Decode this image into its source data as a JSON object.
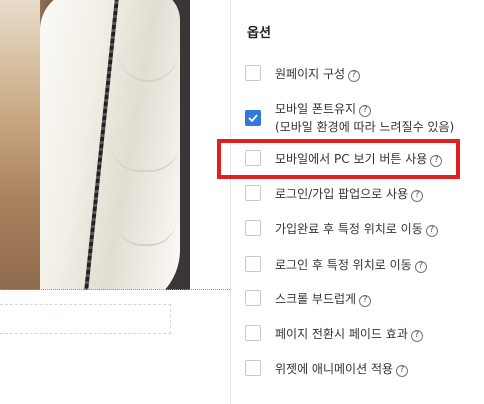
{
  "options_panel": {
    "title": "옵션",
    "help_icon_glyph": "?",
    "items": [
      {
        "label": "원페이지 구성",
        "checked": false
      },
      {
        "label": "모바일 폰트유지",
        "sublabel": "(모바일 환경에 따라 느려질수 있음)",
        "checked": true
      },
      {
        "label": "모바일에서 PC 보기 버튼 사용",
        "checked": false,
        "highlighted": true
      },
      {
        "label": "로그인/가입 팝업으로 사용",
        "checked": false
      },
      {
        "label": "가입완료 후 특정 위치로 이동",
        "checked": false
      },
      {
        "label": "로그인 후 특정 위치로 이동",
        "checked": false
      },
      {
        "label": "스크롤 부드럽게",
        "checked": false
      },
      {
        "label": "페이지 전환시 페이드 효과",
        "checked": false
      },
      {
        "label": "위젯에 애니메이션 적용",
        "checked": false
      }
    ]
  },
  "colors": {
    "checkbox_checked": "#2f7ad8",
    "highlight_border": "#e32020"
  }
}
